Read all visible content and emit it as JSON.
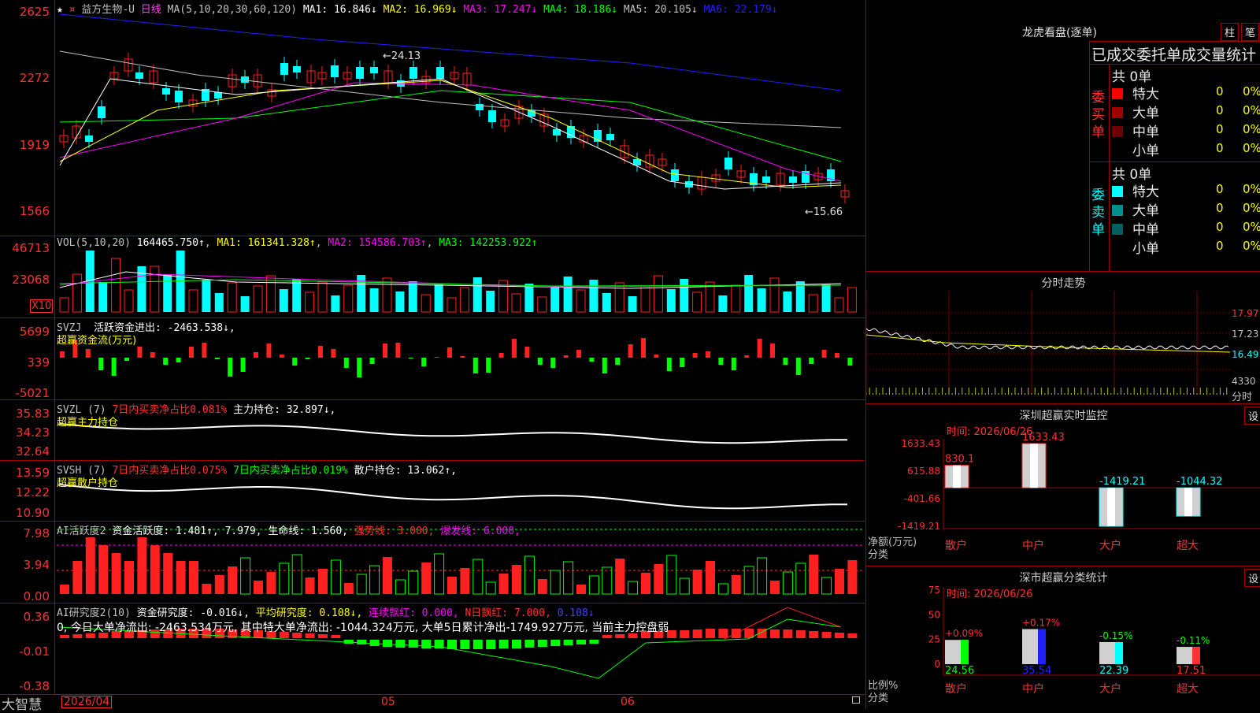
{
  "stock": {
    "name": "益方生物-U",
    "period": "日线",
    "star": "★"
  },
  "main": {
    "ma_label": "MA(5,10,20,30,60,120)",
    "ma": [
      {
        "label": "MA1: 16.846↓",
        "color": "#ffffff"
      },
      {
        "label": "MA2: 16.969↓",
        "color": "#ffff00"
      },
      {
        "label": "MA3: 17.247↓",
        "color": "#ff00ff"
      },
      {
        "label": "MA4: 18.186↓",
        "color": "#00ff00"
      },
      {
        "label": "MA5: 20.105↓",
        "color": "#c0c0c0"
      },
      {
        "label": "MA6: 22.179↓",
        "color": "#2020ff"
      }
    ],
    "yticks": [
      "2625",
      "2272",
      "1919",
      "1566"
    ],
    "high_label": "24.13",
    "low_label": "15.66"
  },
  "vol": {
    "label": "VOL(5,10,20)",
    "value": "164465.750↑",
    "ma1": "MA1: 161341.328↑",
    "ma2": "MA2: 154586.703↑",
    "ma3": "MA3: 142253.922↑",
    "yticks": [
      "46713",
      "23068"
    ],
    "unit": "X10"
  },
  "svzj": {
    "label": "SVZJ",
    "text": "活跃资金进出: -2463.538↓,",
    "sub": "超赢资金流(万元)",
    "yticks": [
      "5699",
      "339",
      "-5021"
    ]
  },
  "svzl": {
    "label": "SVZL (7)",
    "t1": "7日内买卖净占比0.081%",
    "t2": "主力持仓: 32.897↓,",
    "sub": "超赢主力持仓",
    "yticks": [
      "35.83",
      "34.23",
      "32.64"
    ]
  },
  "svsh": {
    "label": "SVSH (7)",
    "t1": "7日内买卖净占比0.075%",
    "t2": "7日内买卖净占比0.019%",
    "t3": "散户持仓: 13.062↑,",
    "sub": "超赢散户持仓",
    "yticks": [
      "13.59",
      "12.22",
      "10.90"
    ]
  },
  "ai1": {
    "label": "AI活跃度2",
    "t1": "资金活跃度: 1.481↑,",
    "t2": "7.979,",
    "t3": "生命线: 1.560,",
    "t4": "强势线: 3.000,",
    "t5": "爆发线: 6.000,",
    "yticks": [
      "7.98",
      "3.94",
      "0.00"
    ]
  },
  "ai2": {
    "label": "AI研究度2(10)",
    "t1": "资金研究度: -0.016↓,",
    "t2": "平均研究度: 0.108↓,",
    "t3": "连续飘红: 0.000,",
    "t4": "N日飘红: 7.000,",
    "t5": "0.108↓",
    "note": "0, 今日大单净流出: -2463.534万元, 其中特大单净流出: -1044.324万元, 大单5日累计净出-1749.927万元, 当前主力控盘弱",
    "yticks": [
      "0.36",
      "-0.01",
      "-0.38"
    ]
  },
  "bottom": {
    "brand": "大智慧",
    "dates": [
      "2026/04",
      "05",
      "06"
    ]
  },
  "lhb": {
    "title": "龙虎看盘(逐单)",
    "btn1": "柱",
    "btn2": "笔",
    "header": "已成交委托单成交量统计",
    "buy": {
      "side": "委买单",
      "total": "共 0单",
      "rows": [
        {
          "name": "特大",
          "v": "0",
          "p": "0%",
          "c": "#ff0000"
        },
        {
          "name": "大单",
          "v": "0",
          "p": "0%",
          "c": "#a00000"
        },
        {
          "name": "中单",
          "v": "0",
          "p": "0%",
          "c": "#700000"
        },
        {
          "name": "小单",
          "v": "0",
          "p": "0%",
          "c": ""
        }
      ]
    },
    "sell": {
      "side": "委卖单",
      "total": "共 0单",
      "rows": [
        {
          "name": "特大",
          "v": "0",
          "p": "0%",
          "c": "#00ffff"
        },
        {
          "name": "大单",
          "v": "0",
          "p": "0%",
          "c": "#009090"
        },
        {
          "name": "中单",
          "v": "0",
          "p": "0%",
          "c": "#006060"
        },
        {
          "name": "小单",
          "v": "0",
          "p": "0%",
          "c": ""
        }
      ]
    }
  },
  "fenshi": {
    "title": "分时走势",
    "yticks": [
      "17.97",
      "17.23",
      "16.49",
      "4330"
    ],
    "label": "分时"
  },
  "sz_monitor": {
    "title": "深圳超赢实时监控",
    "btn": "设",
    "date": "时间: 2026/06/26",
    "yticks": [
      "1633.43",
      "615.88",
      "-401.66",
      "-1419.21"
    ],
    "ylabel": "净额(万元)",
    "xlabel": "分类",
    "bars": [
      {
        "cat": "散户",
        "value": 830.1,
        "label": "830.1"
      },
      {
        "cat": "中户",
        "value": 1633.43,
        "label": "1633.43"
      },
      {
        "cat": "大户",
        "value": -1419.21,
        "label": "-1419.21"
      },
      {
        "cat": "超大",
        "value": -1044.32,
        "label": "-1044.32"
      }
    ]
  },
  "sh_stats": {
    "title": "深市超赢分类统计",
    "btn": "设",
    "date": "时间: 2026/06/26",
    "yticks": [
      "75",
      "50",
      "25",
      "0"
    ],
    "ylabel": "比例%",
    "xlabel": "分类",
    "bars": [
      {
        "cat": "散户",
        "value": 24.56,
        "change": "+0.09%",
        "label": "24.56"
      },
      {
        "cat": "中户",
        "value": 35.54,
        "change": "+0.17%",
        "label": "35.54"
      },
      {
        "cat": "大户",
        "value": 22.39,
        "change": "-0.15%",
        "label": "22.39"
      },
      {
        "cat": "超大",
        "value": 17.51,
        "change": "-0.11%",
        "label": "17.51"
      }
    ]
  }
}
